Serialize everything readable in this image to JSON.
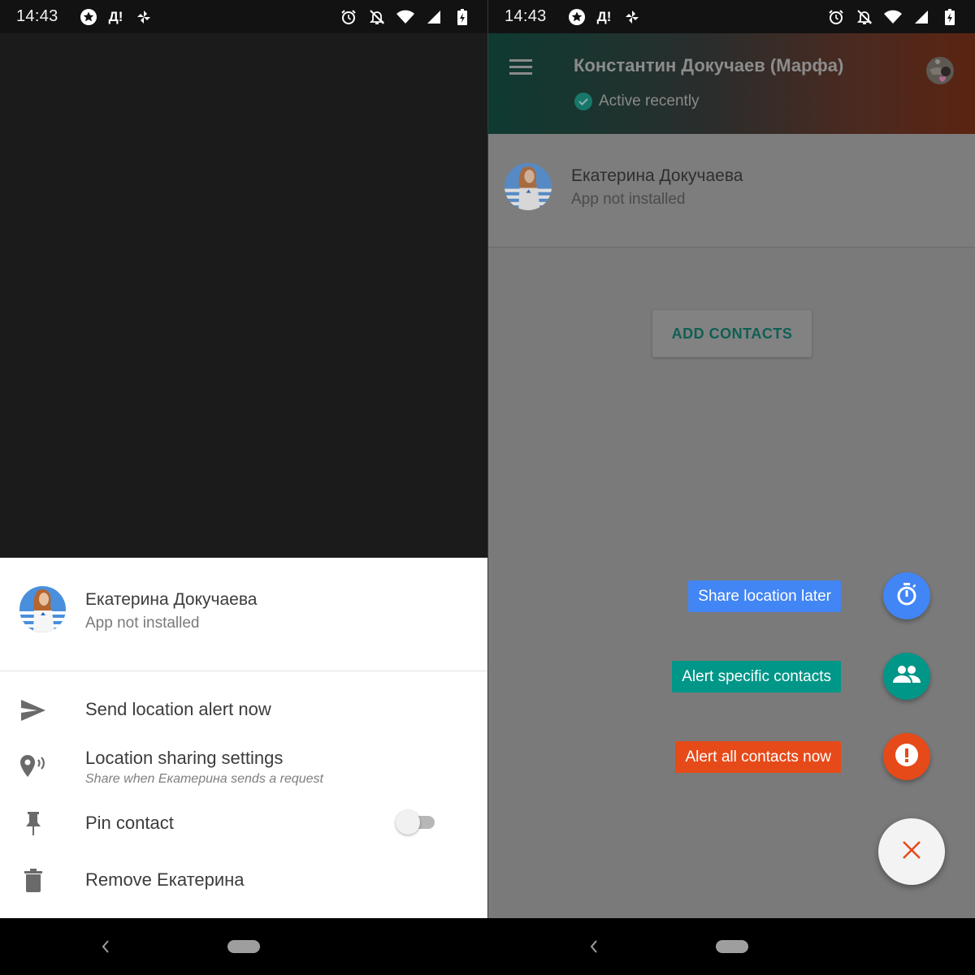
{
  "status_bar": {
    "time": "14:43",
    "notification_icons": [
      "star-badge-icon",
      "app-d-alert-icon",
      "pinwheel-icon"
    ],
    "notification_text": {
      "d_alert": "Д!"
    },
    "system_icons": [
      "alarm-icon",
      "notifications-off-icon",
      "wifi-icon",
      "signal-icon",
      "battery-charging-icon"
    ]
  },
  "left_screen": {
    "bottom_sheet": {
      "contact": {
        "name": "Екатерина Докучаева",
        "status": "App not installed"
      },
      "menu": [
        {
          "icon": "send-icon",
          "label": "Send location alert now"
        },
        {
          "icon": "location-sharing-icon",
          "label": "Location sharing settings",
          "sublabel": "Share when Екатерина sends a request"
        },
        {
          "icon": "pin-icon",
          "label": "Pin contact",
          "toggle": false
        },
        {
          "icon": "trash-icon",
          "label": "Remove Екатерина"
        }
      ]
    }
  },
  "right_screen": {
    "appbar": {
      "title": "Константин Докучаев (Марфа)",
      "status": "Active recently"
    },
    "contact_card": {
      "name": "Екатерина Докучаева",
      "status": "App not installed"
    },
    "add_contacts_label": "ADD CONTACTS",
    "speed_dial": [
      {
        "label": "Share location later",
        "icon": "timer-icon",
        "color": "#4285f4"
      },
      {
        "label": "Alert specific contacts",
        "icon": "people-icon",
        "color": "#009688"
      },
      {
        "label": "Alert all contacts now",
        "icon": "alert-icon",
        "color": "#e64a19"
      }
    ],
    "close_fab": {
      "icon": "close-icon",
      "color": "#e64a19"
    }
  },
  "colors": {
    "accent_teal": "#009688",
    "accent_blue": "#4285f4",
    "accent_orange": "#e64a19"
  }
}
